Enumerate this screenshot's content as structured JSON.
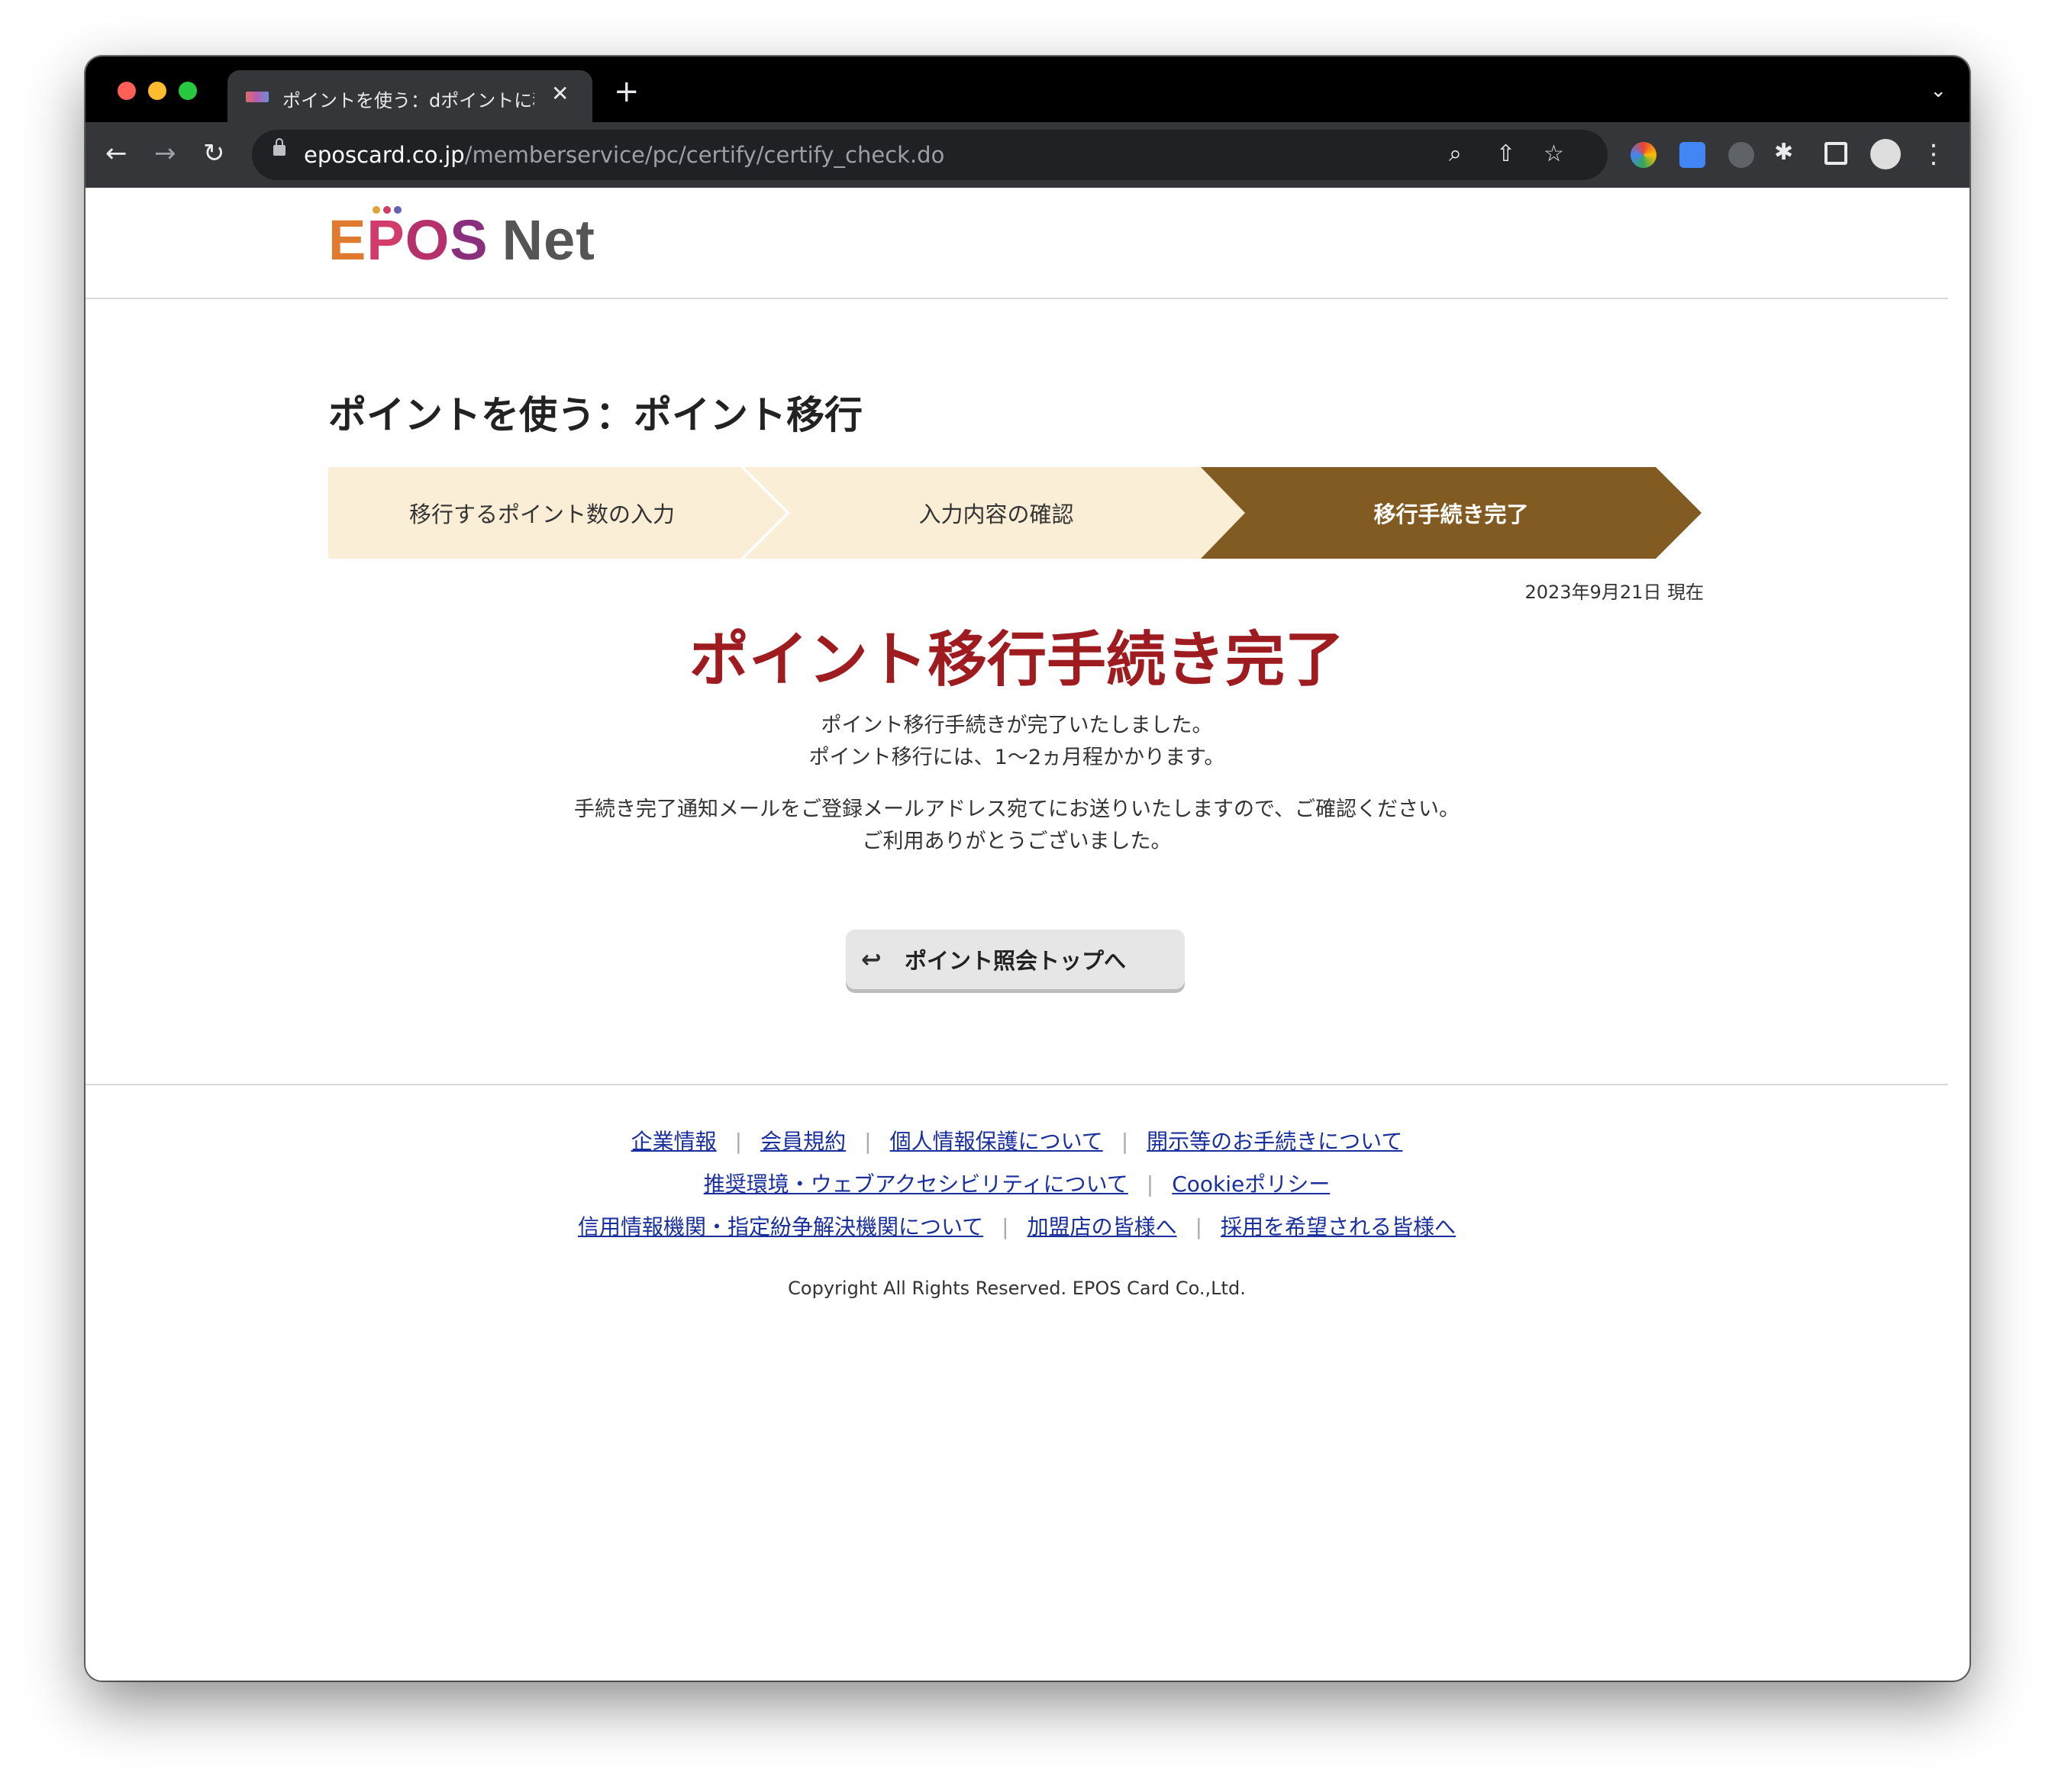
{
  "browser": {
    "tab_title": "ポイントを使う：dポイントに移行",
    "tab_close": "✕",
    "new_tab": "+",
    "url_host": "eposcard.co.jp",
    "url_path": "/memberservice/pc/certify/certify_check.do"
  },
  "header": {
    "logo_epos": "EPOS",
    "logo_net": "Net"
  },
  "page": {
    "title": "ポイントを使う：ポイント移行",
    "steps": [
      {
        "label": "移行するポイント数の入力",
        "state": "done"
      },
      {
        "label": "入力内容の確認",
        "state": "done"
      },
      {
        "label": "移行手続き完了",
        "state": "current"
      }
    ],
    "as_of": "2023年9月21日 現在",
    "complete_title": "ポイント移行手続き完了",
    "message_1a": "ポイント移行手続きが完了いたしました。",
    "message_1b": "ポイント移行には、1〜2ヵ月程かかります。",
    "message_2a": "手続き完了通知メールをご登録メールアドレス宛てにお送りいたしますので、ご確認ください。",
    "message_2b": "ご利用ありがとうございました。",
    "back_button": "ポイント照会トップへ"
  },
  "footer": {
    "links_row1": [
      "企業情報",
      "会員規約",
      "個人情報保護について",
      "開示等のお手続きについて"
    ],
    "links_row2": [
      "推奨環境・ウェブアクセシビリティについて",
      "Cookieポリシー"
    ],
    "links_row3": [
      "信用情報機関・指定紛争解決機関について",
      "加盟店の皆様へ",
      "採用を希望される皆様へ"
    ],
    "copyright": "Copyright All Rights Reserved. EPOS Card Co.,Ltd."
  },
  "colors": {
    "accent_red": "#9e1c20",
    "step_active": "#825b22",
    "step_inactive": "#fbeed6",
    "link": "#1a2f9e"
  }
}
